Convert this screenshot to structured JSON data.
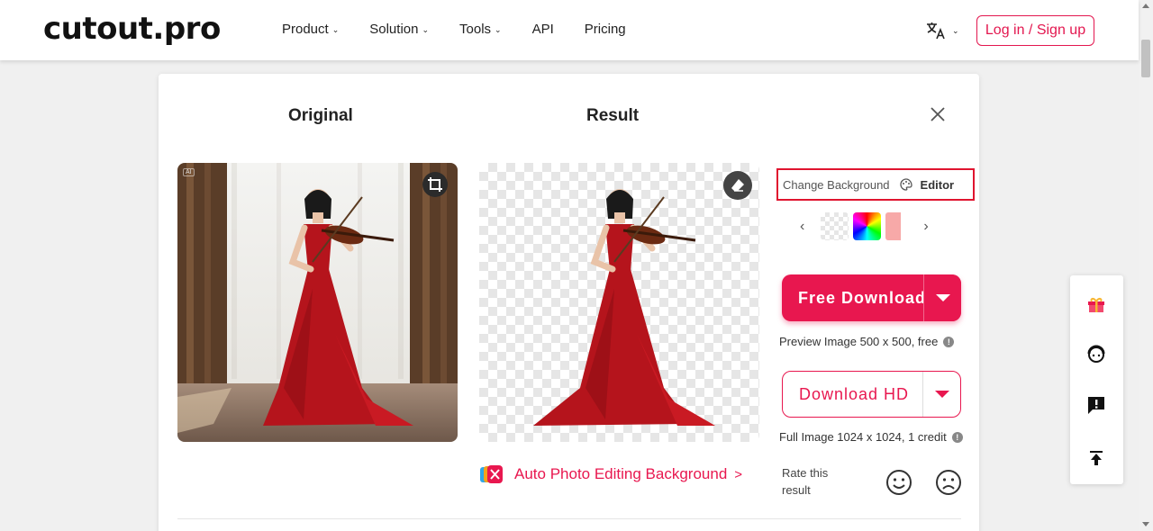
{
  "header": {
    "logo": "cutout.pro",
    "nav": [
      {
        "label": "Product",
        "has_menu": true
      },
      {
        "label": "Solution",
        "has_menu": true
      },
      {
        "label": "Tools",
        "has_menu": true
      },
      {
        "label": "API",
        "has_menu": false
      },
      {
        "label": "Pricing",
        "has_menu": false
      }
    ],
    "language_icon": "translate-icon",
    "login_label": "Log in / Sign up"
  },
  "main": {
    "original_title": "Original",
    "result_title": "Result",
    "ai_badge": "AI",
    "change_background_label": "Change Background",
    "editor_label": "Editor",
    "swatch_colors": [
      "transparent",
      "rainbow",
      "#f7a9a8"
    ],
    "free_download_label": "Free Download",
    "free_download_note": "Preview Image 500 x 500, free",
    "download_hd_label": "Download HD",
    "download_hd_note": "Full Image 1024 x 1024, 1 credit",
    "auto_edit_label": "Auto Photo Editing Background",
    "auto_edit_chevron": ">",
    "rate_label": "Rate this result"
  },
  "side_bar": {
    "icons": [
      "gift-icon",
      "support-agent-icon",
      "feedback-icon",
      "back-to-top-icon"
    ]
  },
  "colors": {
    "accent": "#e8174f",
    "highlight_border": "#e0142f",
    "dress": "#b5141c"
  }
}
